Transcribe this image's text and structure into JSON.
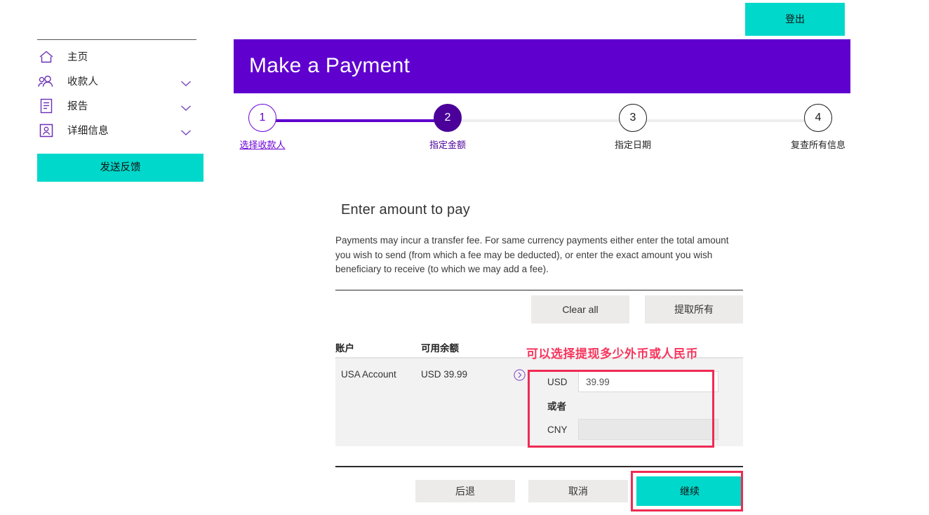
{
  "header": {
    "logout_label": "登出"
  },
  "sidebar": {
    "items": [
      {
        "label": "主页",
        "icon": "home-icon",
        "has_chevron": false
      },
      {
        "label": "收款人",
        "icon": "people-icon",
        "has_chevron": true
      },
      {
        "label": "报告",
        "icon": "document-icon",
        "has_chevron": true
      },
      {
        "label": "详细信息",
        "icon": "id-card-icon",
        "has_chevron": true
      }
    ],
    "feedback_label": "发送反馈"
  },
  "banner": {
    "title": "Make a Payment",
    "color": "#5f00cf"
  },
  "stepper": {
    "steps": [
      {
        "number": "1",
        "label": "选择收款人",
        "state": "done"
      },
      {
        "number": "2",
        "label": "指定金额",
        "state": "current"
      },
      {
        "number": "3",
        "label": "指定日期",
        "state": "todo"
      },
      {
        "number": "4",
        "label": "复查所有信息",
        "state": "todo"
      }
    ]
  },
  "form": {
    "heading": "Enter amount to pay",
    "description": "Payments may incur a transfer fee. For same currency payments either enter the total amount you wish to send (from which a fee may be deducted), or enter the exact amount you wish beneficiary to receive (to which we may add a fee).",
    "clear_all_label": "Clear all",
    "withdraw_all_label": "提取所有"
  },
  "table": {
    "columns": [
      "账户",
      "可用余额"
    ],
    "rows": [
      {
        "account": "USA Account",
        "balance": "USD 39.99",
        "expand_icon": "chevron-right-circle-icon",
        "amounts": {
          "primary_currency": "USD",
          "primary_value": "39.99",
          "or_label": "或者",
          "secondary_currency": "CNY",
          "secondary_value": ""
        }
      }
    ]
  },
  "annotation": {
    "text": "可以选择提现多少外币或人民币",
    "color": "#f7355c"
  },
  "footer": {
    "back_label": "后退",
    "cancel_label": "取消",
    "continue_label": "继续"
  },
  "theme": {
    "accent_purple": "#5f00cf",
    "accent_teal": "#00d8cb",
    "highlight_red": "#ef2b53",
    "gray_button": "#ecebe9",
    "row_background": "#f2f2f2"
  }
}
